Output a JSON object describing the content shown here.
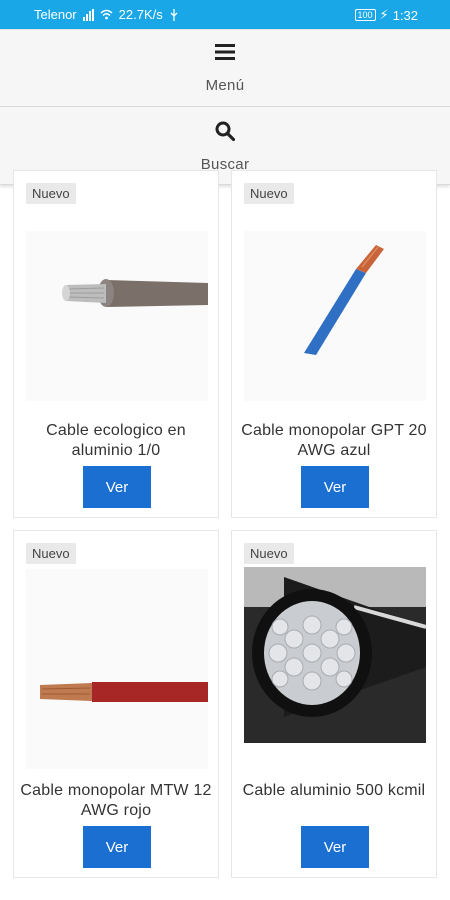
{
  "status_bar": {
    "carrier": "Telenor",
    "speed": "22.7K/s",
    "battery": "100",
    "time": "1:32"
  },
  "nav": {
    "menu_label": "Menú",
    "search_label": "Buscar"
  },
  "products": [
    {
      "badge": "Nuevo",
      "title": "Cable ecologico en aluminio 1/0",
      "button": "Ver",
      "image": "gray-aluminum-cable"
    },
    {
      "badge": "Nuevo",
      "title": "Cable monopolar GPT 20 AWG azul",
      "button": "Ver",
      "image": "blue-copper-wire"
    },
    {
      "badge": "Nuevo",
      "title": "Cable monopolar MTW 12 AWG rojo",
      "button": "Ver",
      "image": "red-copper-wire"
    },
    {
      "badge": "Nuevo",
      "title": "Cable aluminio 500 kcmil",
      "button": "Ver",
      "image": "aluminum-500-kcmil-cable"
    }
  ],
  "colors": {
    "status_bar": "#1aa7e8",
    "button": "#1a6fd1"
  }
}
